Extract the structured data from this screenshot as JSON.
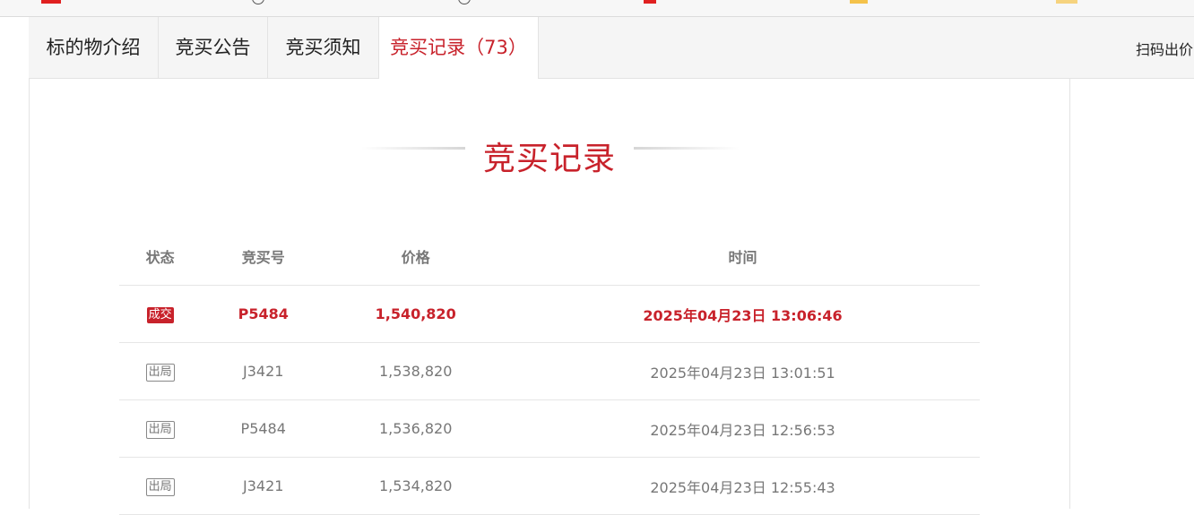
{
  "tabs": [
    {
      "label": "标的物介绍"
    },
    {
      "label": "竞买公告"
    },
    {
      "label": "竞买须知"
    },
    {
      "label": "竞买记录（73）"
    }
  ],
  "header_right": {
    "scan_label": "扫码出价"
  },
  "section": {
    "title": "竞买记录"
  },
  "table": {
    "headers": {
      "status": "状态",
      "bid_no": "竞买号",
      "price": "价格",
      "time": "时间"
    },
    "rows": [
      {
        "status": "成交",
        "bid_no": "P5484",
        "price": "1,540,820",
        "time": "2025年04月23日 13:06:46"
      },
      {
        "status": "出局",
        "bid_no": "J3421",
        "price": "1,538,820",
        "time": "2025年04月23日 13:01:51"
      },
      {
        "status": "出局",
        "bid_no": "P5484",
        "price": "1,536,820",
        "time": "2025年04月23日 12:56:53"
      },
      {
        "status": "出局",
        "bid_no": "J3421",
        "price": "1,534,820",
        "time": "2025年04月23日 12:55:43"
      }
    ]
  },
  "colors": {
    "accent": "#c8222b",
    "muted": "#777777"
  }
}
